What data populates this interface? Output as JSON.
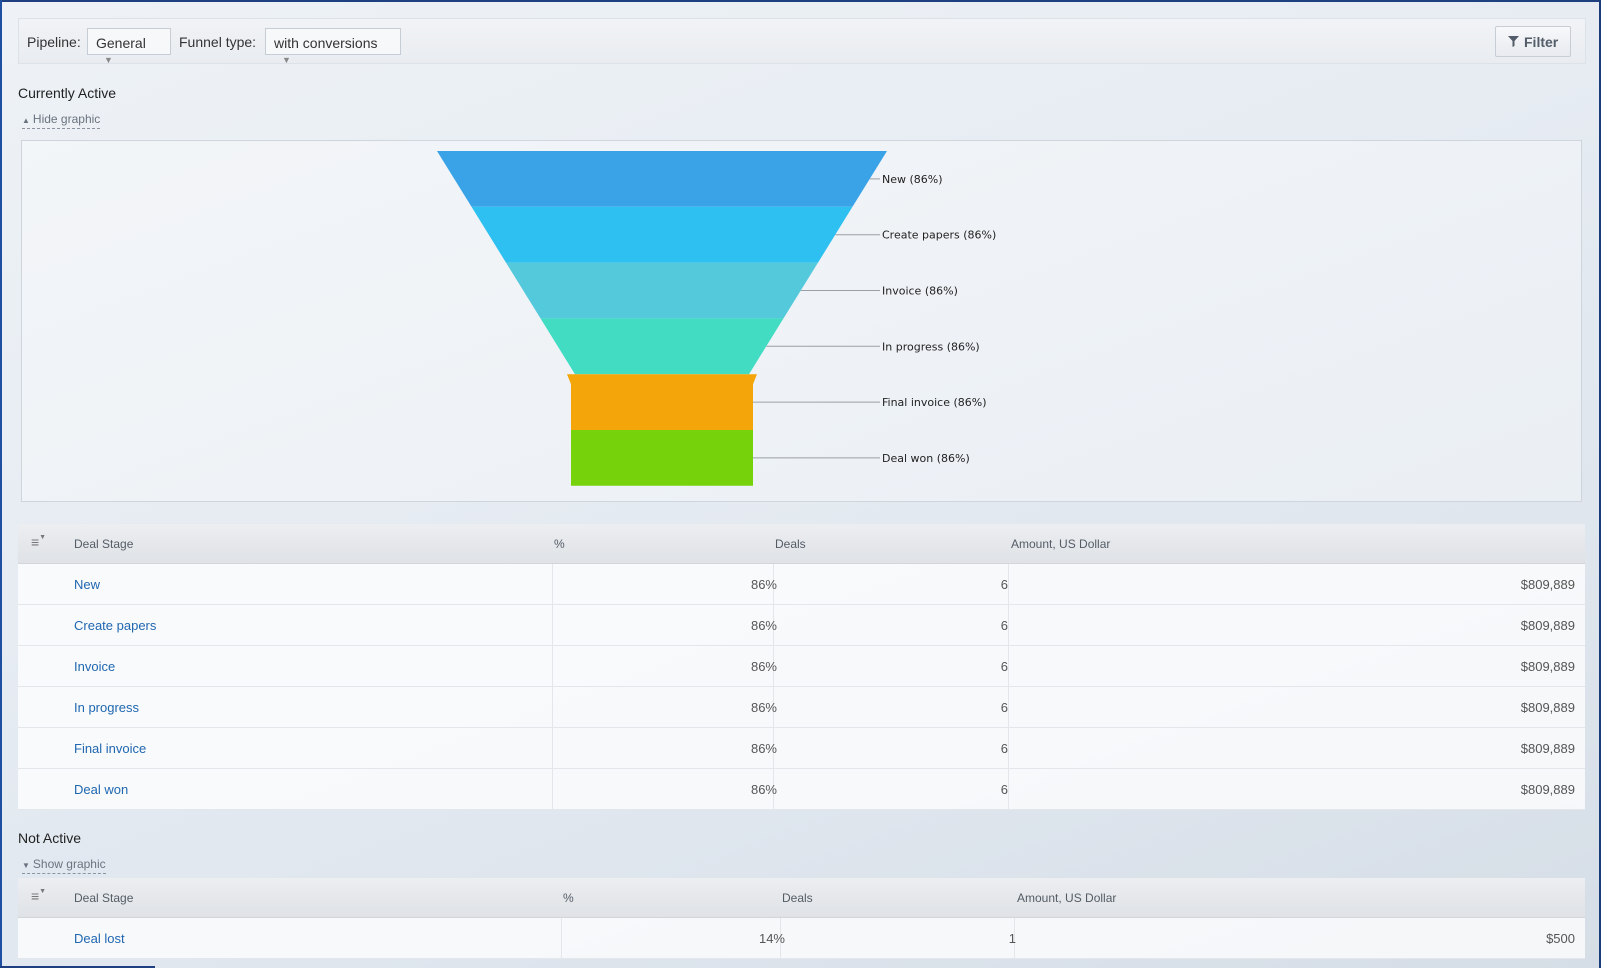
{
  "toolbar": {
    "pipeline_label": "Pipeline:",
    "pipeline_value": "General",
    "funnel_type_label": "Funnel type:",
    "funnel_type_value": "with conversions",
    "filter_label": "Filter",
    "filter_icon": "funnel-filter-icon"
  },
  "active": {
    "title": "Currently Active",
    "toggle_label": "Hide graphic",
    "toggle_icon": "chevron-up-icon"
  },
  "chart_data": {
    "type": "funnel",
    "title": "",
    "categories": [
      "New",
      "Create papers",
      "Invoice",
      "In progress",
      "Final invoice",
      "Deal won"
    ],
    "values": [
      86,
      86,
      86,
      86,
      86,
      86
    ],
    "labels": [
      "New (86%)",
      "Create papers (86%)",
      "Invoice (86%)",
      "In progress (86%)",
      "Final invoice (86%)",
      "Deal won (86%)"
    ],
    "colors": [
      "#3aa3e8",
      "#2dc0f0",
      "#55c9dc",
      "#42dcc3",
      "#f4a50a",
      "#76d20a"
    ]
  },
  "active_table": {
    "columns": [
      "Deal Stage",
      "%",
      "Deals",
      "Amount, US Dollar"
    ],
    "rows": [
      {
        "stage": "New",
        "percent": "86%",
        "deals": "6",
        "amount": "$809,889"
      },
      {
        "stage": "Create papers",
        "percent": "86%",
        "deals": "6",
        "amount": "$809,889"
      },
      {
        "stage": "Invoice",
        "percent": "86%",
        "deals": "6",
        "amount": "$809,889"
      },
      {
        "stage": "In progress",
        "percent": "86%",
        "deals": "6",
        "amount": "$809,889"
      },
      {
        "stage": "Final invoice",
        "percent": "86%",
        "deals": "6",
        "amount": "$809,889"
      },
      {
        "stage": "Deal won",
        "percent": "86%",
        "deals": "6",
        "amount": "$809,889"
      }
    ]
  },
  "inactive": {
    "title": "Not Active",
    "toggle_label": "Show graphic",
    "toggle_icon": "chevron-down-icon"
  },
  "inactive_table": {
    "columns": [
      "Deal Stage",
      "%",
      "Deals",
      "Amount, US Dollar"
    ],
    "rows": [
      {
        "stage": "Deal lost",
        "percent": "14%",
        "deals": "1",
        "amount": "$500"
      }
    ]
  }
}
